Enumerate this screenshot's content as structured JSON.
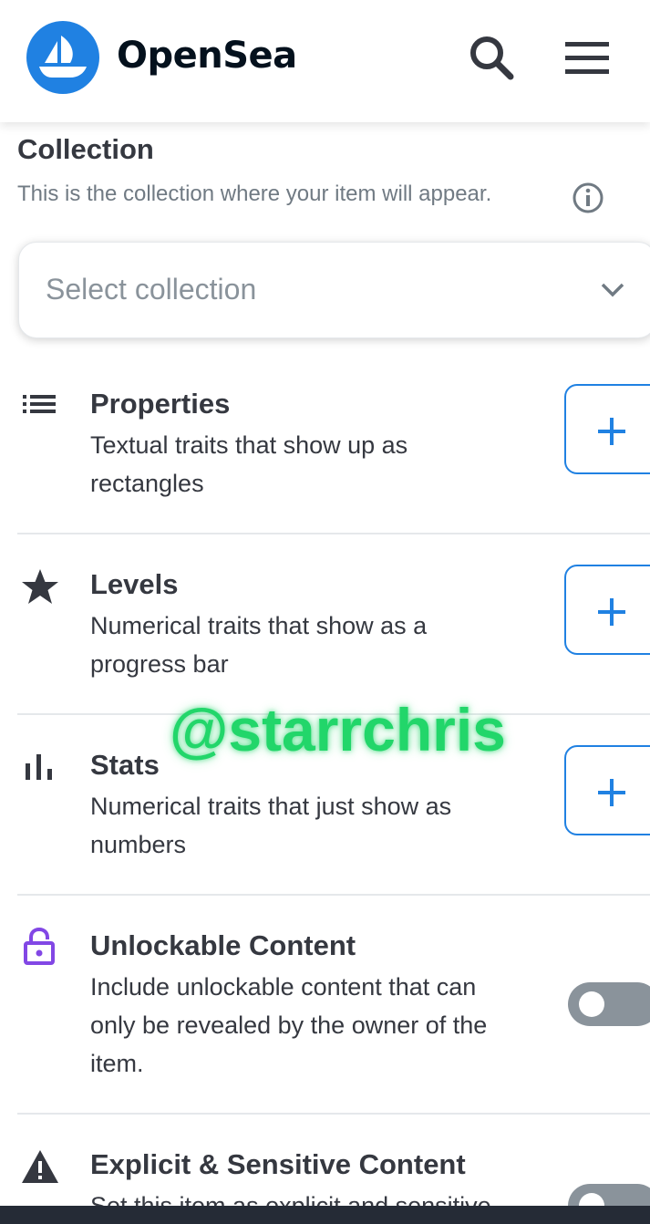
{
  "header": {
    "brand": "OpenSea",
    "icons": {
      "logo": "opensea-ship-logo",
      "search": "search-icon",
      "menu": "hamburger-menu-icon"
    }
  },
  "collection": {
    "title": "Collection",
    "subtitle": "This is the collection where your item will appear.",
    "select_placeholder": "Select collection"
  },
  "rows": [
    {
      "icon": "list-icon",
      "title": "Properties",
      "desc_line1": "Textual traits that show up as",
      "desc_line2": "rectangles",
      "action": "add"
    },
    {
      "icon": "star-icon",
      "title": "Levels",
      "desc_line1": "Numerical traits that show as a",
      "desc_line2": "progress bar",
      "action": "add"
    },
    {
      "icon": "bar-chart-icon",
      "title": "Stats",
      "desc_line1": "Numerical traits that just show as",
      "desc_line2": "numbers",
      "action": "add"
    },
    {
      "icon": "lock-icon",
      "title": "Unlockable Content",
      "desc_line1": "Include unlockable content that can",
      "desc_line2": "only be revealed by the owner of the",
      "desc_line3": "item.",
      "action": "toggle",
      "toggle_on": false
    },
    {
      "icon": "warning-icon",
      "title": "Explicit & Sensitive Content",
      "desc_line1": "Set this item as explicit and sensitive",
      "action": "toggle",
      "toggle_on": false
    }
  ],
  "watermark": "@starrchris",
  "colors": {
    "accent": "#2081e2",
    "text": "#353840",
    "muted": "#707a83",
    "lock": "#8247e5",
    "toggle_off": "#8a939b"
  }
}
